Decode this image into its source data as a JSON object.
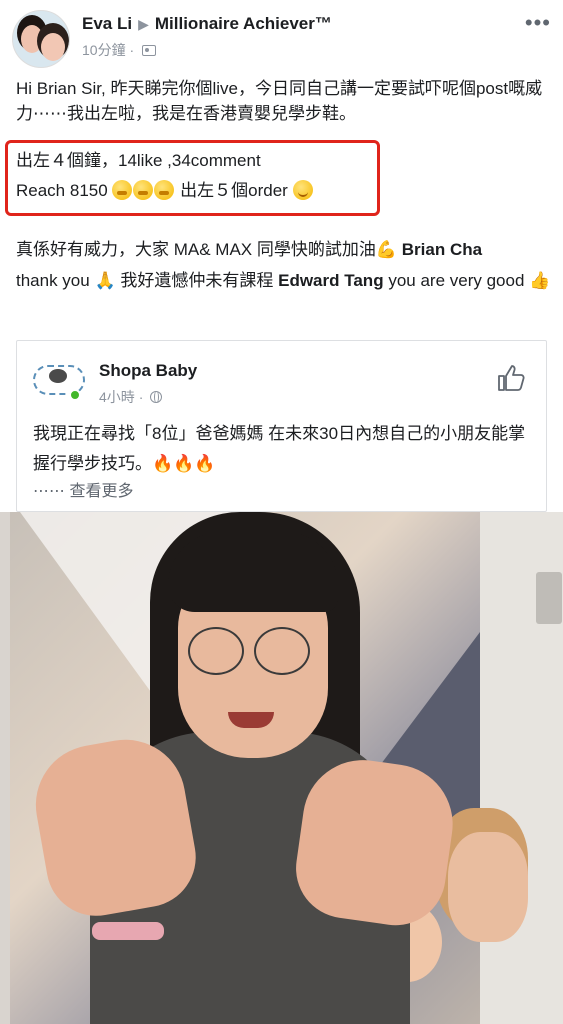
{
  "header": {
    "author": "Eva Li",
    "group": "Millionaire Achiever™",
    "time": "10分鐘",
    "separator": "·"
  },
  "post": {
    "text": "Hi Brian Sir, 昨天睇完你個live，今日同自己講一定要試吓呢個post嘅威力⋯⋯我出左啦，我是在香港賣嬰兒學步鞋。",
    "highlight_line1": "出左４個鐘，14like ,34comment",
    "highlight_line2_prefix": "Reach 8150",
    "highlight_line2_suffix": "出左５個order",
    "body_part1": "真係好有威力，大家 MA& MAX 同學快啲試加油",
    "tag1": "Brian Cha",
    "body_part2": "thank you",
    "body_part3": "我好遺憾仲未有課程",
    "tag2": "Edward Tang",
    "body_part4": "you are very good"
  },
  "shared_card": {
    "page_name": "Shopa Baby",
    "time": "4小時",
    "separator": "·",
    "text": "我現正在尋找「8位」爸爸媽媽 在未來30日內想自己的小朋友能掌握行學步技巧。",
    "fire": "🔥🔥🔥",
    "see_more": "⋯⋯ 查看更多"
  },
  "icons": {
    "more": "more-icon",
    "audience": "group-audience-icon",
    "globe": "globe-icon",
    "like": "thumbs-up-icon"
  },
  "colors": {
    "highlight_border": "#e0241b",
    "text": "#1c1e21",
    "meta": "#8d949e"
  }
}
